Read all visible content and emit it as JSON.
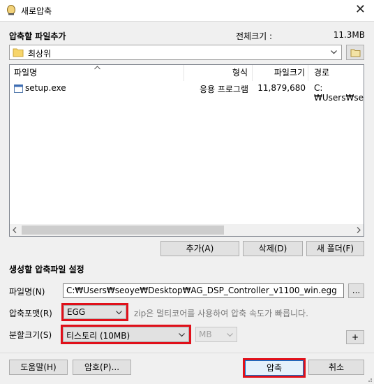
{
  "window": {
    "title": "새로압축",
    "close_glyph": "✕"
  },
  "source": {
    "section_label": "압축할 파일추가",
    "total_size_label": "전체크기 :",
    "total_size_value": "11.3MB",
    "folder_combo_value": "최상위"
  },
  "file_list": {
    "columns": [
      "파일명",
      "형식",
      "파일크기",
      "경로"
    ],
    "rows": [
      {
        "name": "setup.exe",
        "type": "응용 프로그램",
        "size": "11,879,680",
        "path": "C:₩Users₩seo"
      }
    ]
  },
  "list_buttons": {
    "add": "추가(A)",
    "delete": "삭제(D)",
    "new_folder": "새 폴더(F)"
  },
  "output": {
    "section_label": "생성할 압축파일 설정",
    "filename_label": "파일명(N)",
    "filename_value": "C:₩Users₩seoye₩Desktop₩AG_DSP_Controller_v1100_win.egg",
    "browse_label": "...",
    "format_label": "압축포맷(R)",
    "format_value": "EGG",
    "format_hint": "zip은 멀티코어를 사용하여 압축 속도가 빠릅니다.",
    "split_label": "분할크기(S)",
    "split_value": "티스토리 (10MB)",
    "unit_value": "MB",
    "plus_label": "+"
  },
  "bottom_buttons": {
    "help": "도움말(H)",
    "password": "암호(P)...",
    "compress": "압축",
    "cancel": "취소"
  },
  "colors": {
    "highlight": "#e0101a"
  }
}
